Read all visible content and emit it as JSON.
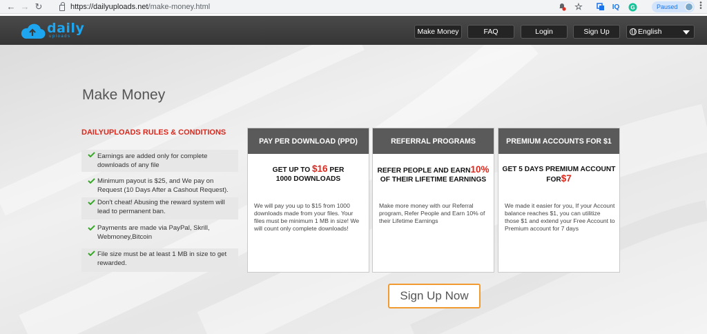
{
  "browser": {
    "url_host": "https://dailyuploads.net",
    "url_path": "/make-money.html",
    "profile_status": "Paused",
    "ext_icons": [
      "IQ"
    ]
  },
  "header": {
    "logo_text": "daily",
    "logo_sub": "uploads",
    "nav": {
      "make_money": "Make Money",
      "faq": "FAQ",
      "login": "Login",
      "signup": "Sign Up"
    },
    "language": "English"
  },
  "page": {
    "title": "Make Money",
    "rules_title": "DAILYUPLOADS RULES & CONDITIONS",
    "rules": [
      "Earnings are added only for complete downloads of any file",
      "Minimum payout is $25, and We pay on Request (10 Days After a Cashout Request).",
      "Don't cheat! Abusing the reward system will lead to permanent ban.",
      "Payments are made via PayPal, Skrill, Webmoney,Bitcoin",
      "File size must be at least 1 MB in size to get rewarded."
    ],
    "cards": [
      {
        "header": "PAY PER DOWNLOAD (PPD)",
        "hl_pre": "GET UP TO ",
        "hl_amount": "$16",
        "hl_post": " PER",
        "hl_line2": "1000 DOWNLOADS",
        "body": "We will pay you up to $15 from 1000 downloads made from your files. Your files must be minimum 1 MB in size! We will count only complete downloads!"
      },
      {
        "header": "REFERRAL PROGRAMS",
        "hl_pre": "REFER PEOPLE AND EARN",
        "hl_amount": "10%",
        "hl_line2": "OF THEIR LIFETIME EARNINGS",
        "body": "Make more money with our Referral program, Refer People and Earn 10% of their Lifetime Earnings"
      },
      {
        "header": "PREMIUM ACCOUNTS FOR $1",
        "hl_pre": "GET 5 DAYS PREMIUM ACCOUNT",
        "hl_line2_pre": "FOR",
        "hl_amount": "$7",
        "body": "We made it easier for you, If your Account balance reaches $1, you can utilitize those $1 and extend your Free Account to Premium account for 7 days"
      }
    ],
    "cta": "Sign Up Now"
  },
  "colors": {
    "accent_red": "#d9281d",
    "brand_blue": "#1ea5f0",
    "cta_orange": "#f19a2f",
    "check_green": "#3aa52b"
  }
}
